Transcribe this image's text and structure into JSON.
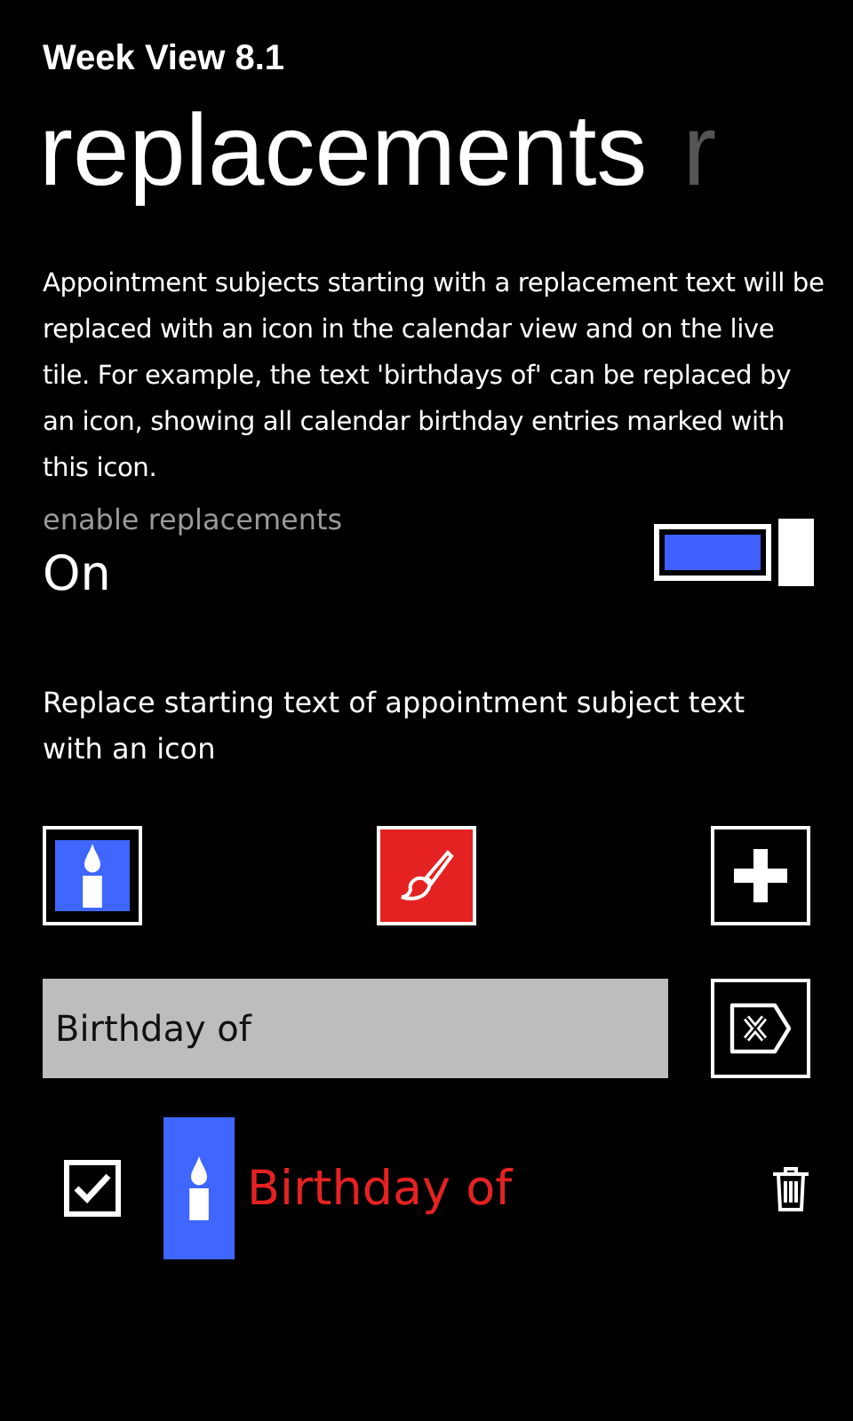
{
  "app_title": "Week View 8.1",
  "pivot": [
    {
      "label": "replacements",
      "selected": true
    },
    {
      "label": "r",
      "selected": false
    }
  ],
  "description": "Appointment subjects starting with a replacement text will be replaced with an icon in the calendar view and on the live tile. For example, the text 'birthdays of' can be replaced by an icon, showing all calendar birthday entries marked with this icon.",
  "toggle": {
    "label": "enable replacements",
    "value": "On",
    "on": true
  },
  "instruction": "Replace starting text of appointment subject text with an icon",
  "text_field": {
    "value": "Birthday of"
  },
  "replacements": [
    {
      "text": "Birthday of",
      "checked": true,
      "color": "#e52222"
    }
  ]
}
